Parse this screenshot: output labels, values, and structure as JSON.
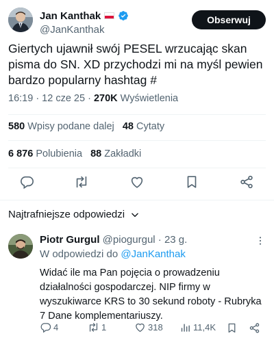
{
  "author": {
    "name": "Jan Kanthak",
    "handle": "@JanKanthak",
    "follow_label": "Obserwuj"
  },
  "tweet": {
    "text": "Giertych ujawnił swój PESEL wrzucając skan pisma do SN. XD przychodzi mi na myśl pewien bardzo popularny hashtag #",
    "time": "16:19 · 12 cze 25 · ",
    "views_count": "270K",
    "views_label": "Wyświetlenia"
  },
  "stats": {
    "reposts_count": "580",
    "reposts_label": "Wpisy podane dalej",
    "quotes_count": "48",
    "quotes_label": "Cytaty",
    "likes_count": "6 876",
    "likes_label": "Polubienia",
    "bookmarks_count": "88",
    "bookmarks_label": "Zakładki"
  },
  "icons": {
    "reply": "reply-icon",
    "repost": "repost-icon",
    "like": "heart-icon",
    "bookmark": "bookmark-icon",
    "share": "share-icon",
    "verified": "verified-badge-icon",
    "flag": "poland-flag-icon"
  },
  "replies": {
    "sort_label": "Najtrafniejsze odpowiedzi"
  },
  "reply": {
    "name": "Piotr Gurgul",
    "handle": "@piogurgul",
    "age": " · 23 g.",
    "reply_to_label": "W odpowiedzi do ",
    "reply_to_mention": "@JanKanthak",
    "text": "Widać ile ma Pan pojęcia o prowadzeniu działalności gospodarczej. NIP firmy w wyszukiwarce KRS to 30 sekund roboty - Rubryka 7 Dane komplementariuszy.",
    "replies_count": "4",
    "reposts_count": "1",
    "likes_count": "318",
    "views_count": "11,4K"
  },
  "colors": {
    "accent": "#1d9bf0",
    "text": "#0f1419",
    "secondary": "#536471",
    "divider": "#eff3f4"
  }
}
